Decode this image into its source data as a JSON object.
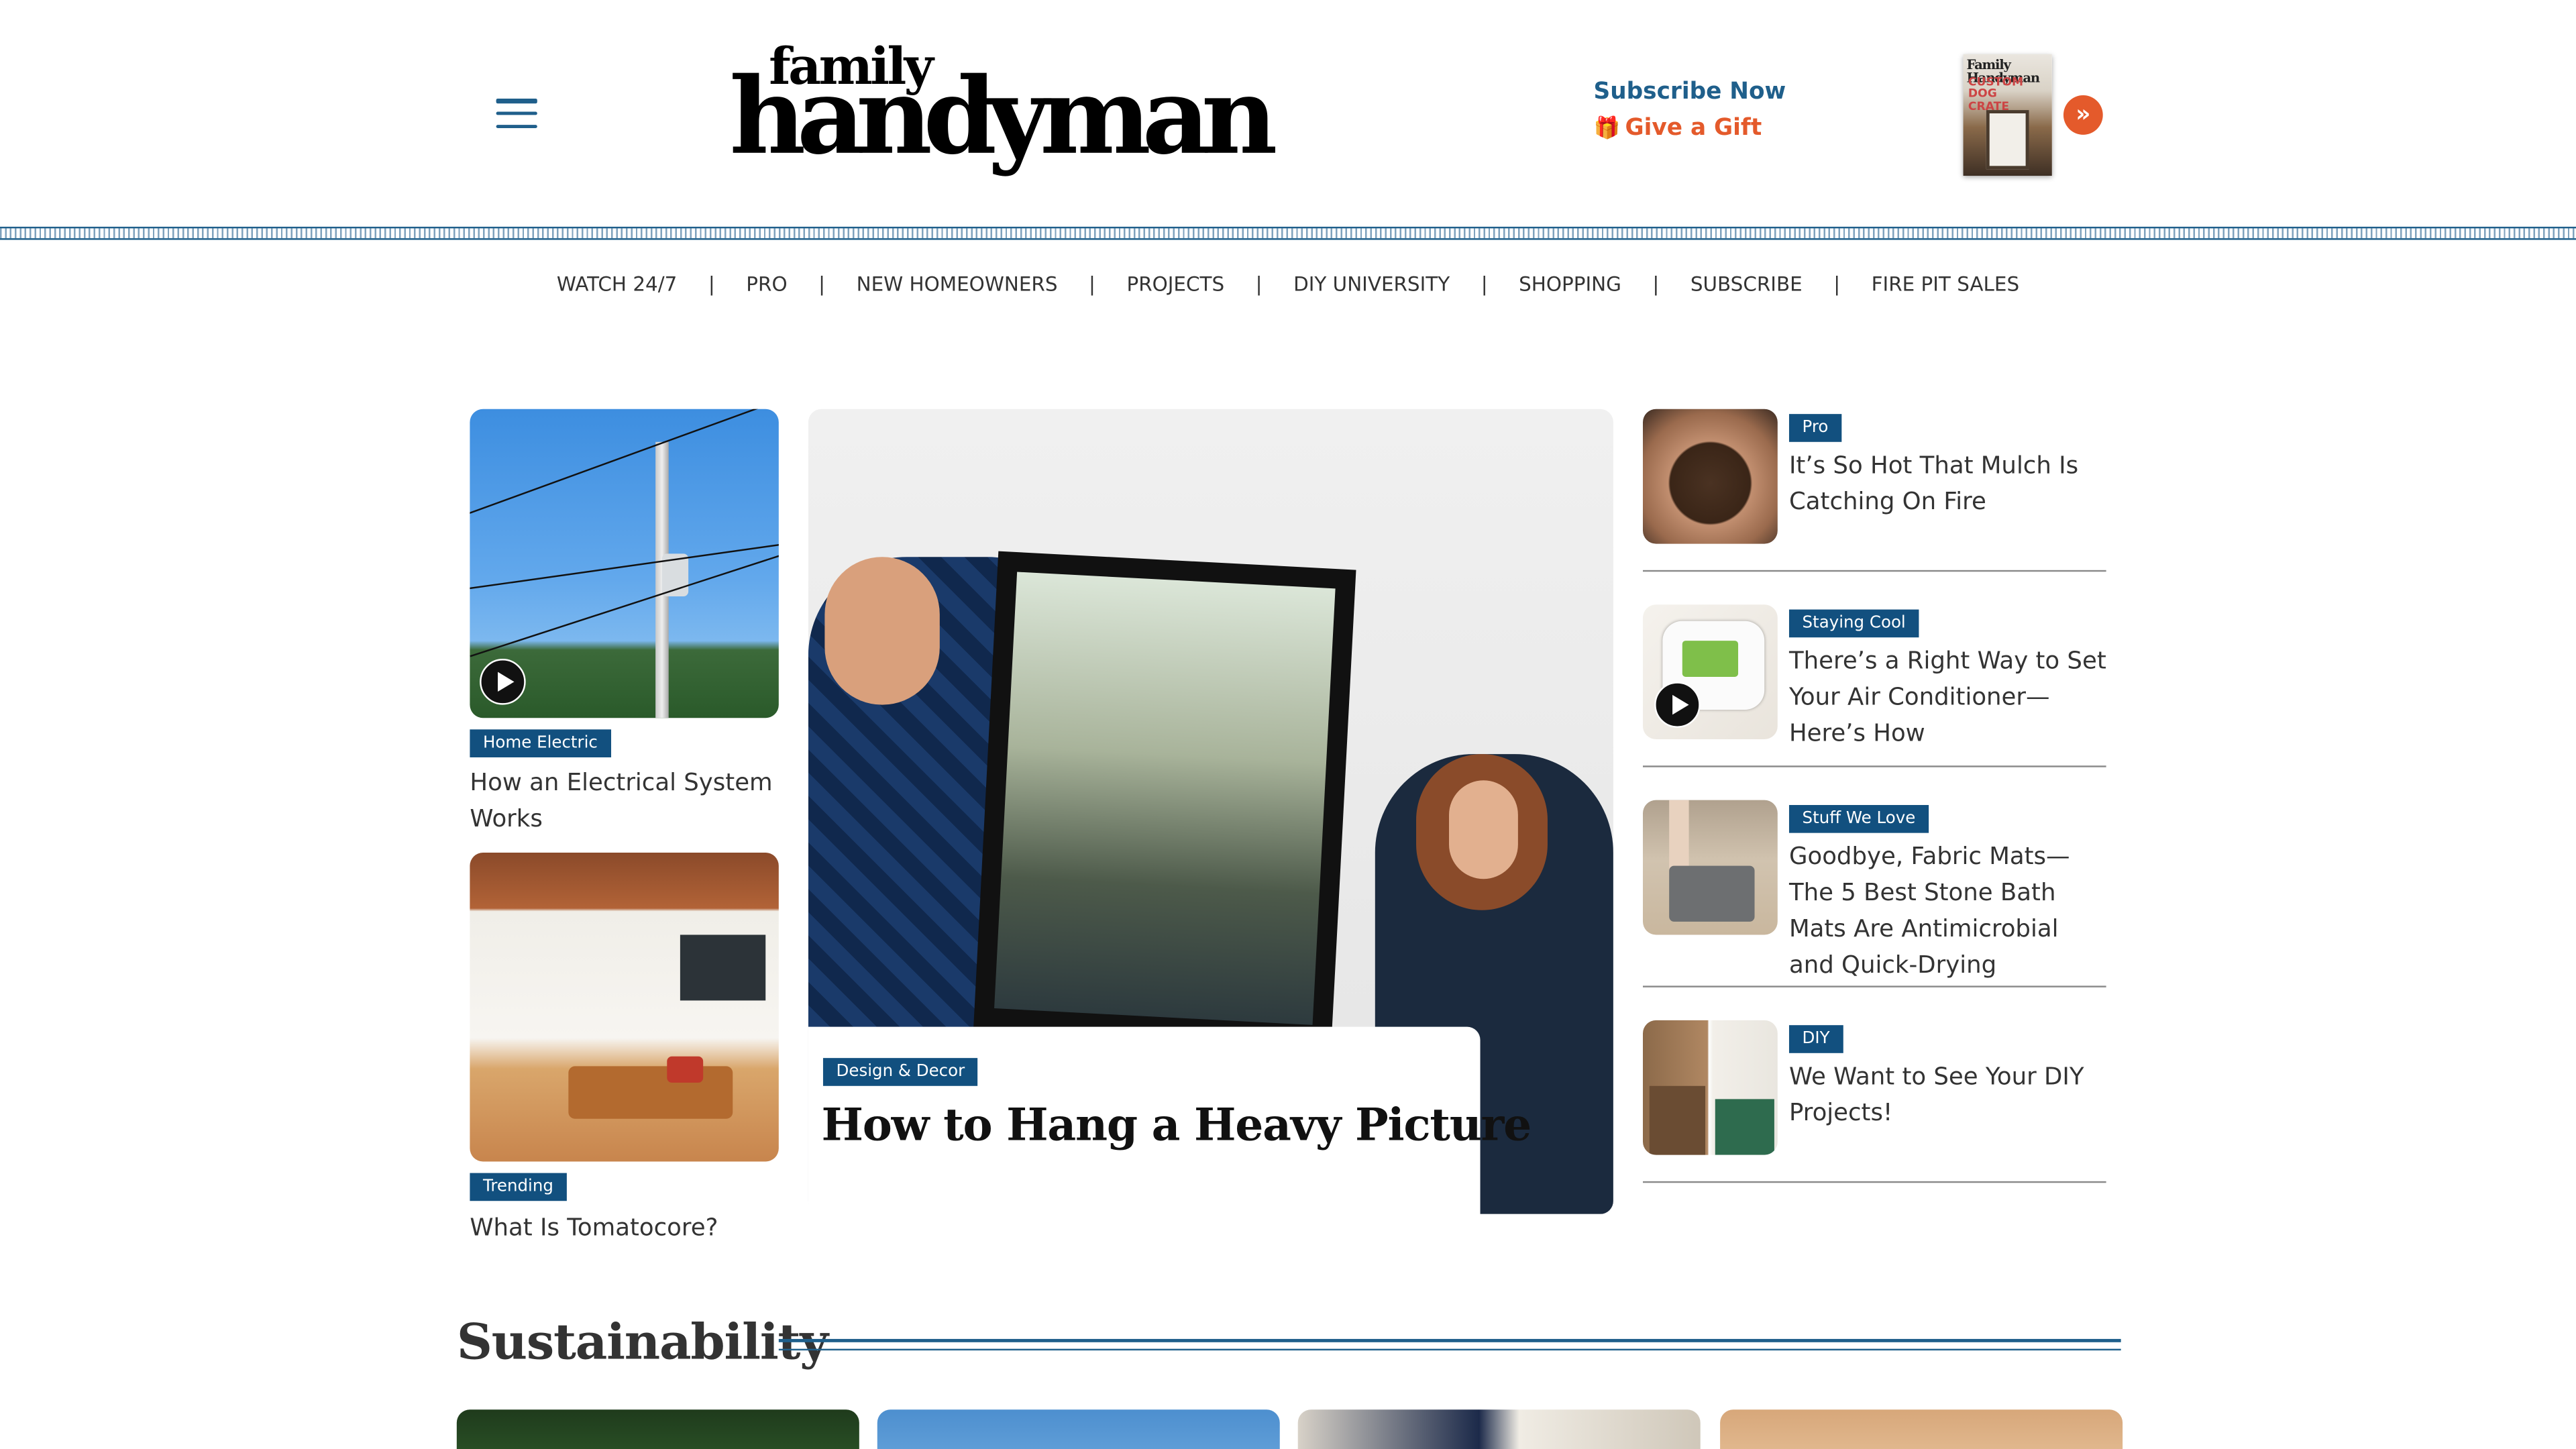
{
  "header": {
    "logo_top": "family",
    "logo_bottom": "handyman",
    "subscribe_label": "Subscribe Now",
    "gift_label": "Give a Gift",
    "magazine_title": "Family Handyman",
    "magazine_headline": "CUSTOM DOG CRATE",
    "arrow_glyph": "»"
  },
  "nav": {
    "items": [
      "WATCH 24/7",
      "PRO",
      "NEW HOMEOWNERS",
      "PROJECTS",
      "DIY UNIVERSITY",
      "SHOPPING",
      "SUBSCRIBE",
      "FIRE PIT SALES"
    ],
    "separator": "|"
  },
  "left_column": [
    {
      "tag": "Home Electric",
      "title": "How an Electrical System Works",
      "has_video": true
    },
    {
      "tag": "Trending",
      "title": "What Is Tomatocore?",
      "has_video": false
    }
  ],
  "hero": {
    "tag": "Design & Decor",
    "title": "How to Hang a Heavy Picture"
  },
  "right_column": [
    {
      "tag": "Pro",
      "title": "It’s So Hot That Mulch Is Catching On Fire",
      "has_video": false
    },
    {
      "tag": "Staying Cool",
      "title": "There’s a Right Way to Set Your Air Conditioner—Here’s How",
      "has_video": true
    },
    {
      "tag": "Stuff We Love",
      "title": "Goodbye, Fabric Mats—The 5 Best Stone Bath Mats Are Antimicrobial and Quick-Drying",
      "has_video": false
    },
    {
      "tag": "DIY",
      "title": "We Want to See Your DIY Projects!",
      "has_video": false
    }
  ],
  "section": {
    "title": "Sustainability"
  },
  "colors": {
    "brand_blue": "#12507f",
    "accent_orange": "#e45a2b",
    "link_blue": "#1f5f8b"
  },
  "icons": [
    "menu-icon",
    "gift-icon",
    "chevron-right-double-icon",
    "play-icon"
  ]
}
